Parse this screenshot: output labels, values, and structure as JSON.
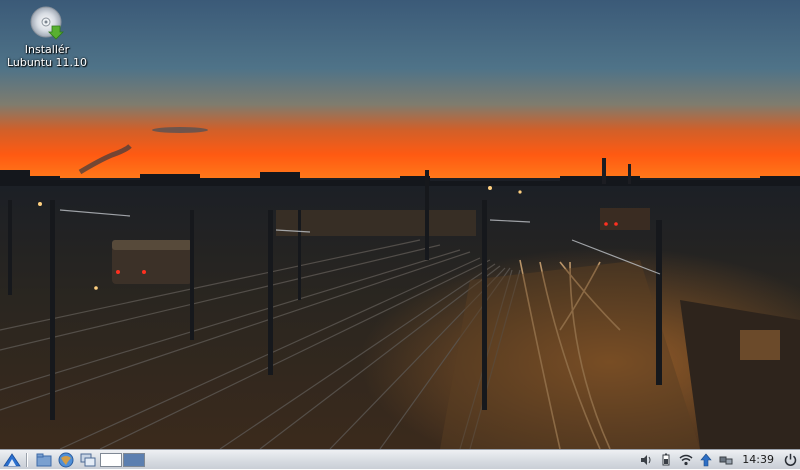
{
  "desktop": {
    "icon": {
      "name": "cd-installer-icon",
      "label_line1": "Installér",
      "label_line2": "Lubuntu 11.10"
    }
  },
  "panel": {
    "menu_icon": "lubuntu-logo-icon",
    "launchers": [
      "file-manager-icon",
      "web-browser-icon",
      "show-desktop-icon"
    ],
    "pager": {
      "desktops": 2,
      "active": 1
    },
    "tray": [
      "volume-icon",
      "battery-icon",
      "network-icon",
      "update-icon",
      "network-manager-icon"
    ],
    "clock": "14:39",
    "power_icon": "power-icon"
  },
  "colors": {
    "sky_top": "#3d5d7a",
    "sky_glow": "#ff5a10",
    "panel": "#d8dce2"
  }
}
